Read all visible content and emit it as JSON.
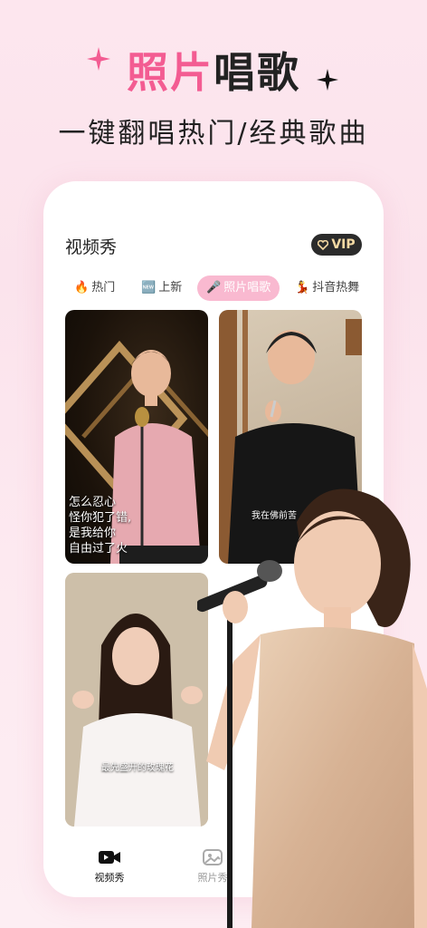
{
  "hero": {
    "title_pink": "照片",
    "title_dark": "唱歌",
    "subtitle": "一键翻唱热门/经典歌曲"
  },
  "app": {
    "title": "视频秀",
    "vip_label": "VIP",
    "tabs": [
      {
        "icon": "🔥",
        "label": "热门"
      },
      {
        "icon": "🆕",
        "label": "上新"
      },
      {
        "icon": "🎤",
        "label": "照片唱歌"
      },
      {
        "icon": "💃",
        "label": "抖音热舞"
      }
    ],
    "cards": [
      {
        "caption_lines": [
          "怎么忍心",
          "怪你犯了错,",
          "是我给你",
          "自由过了火"
        ]
      },
      {
        "caption": "我在佛前苦"
      },
      {
        "caption": "最先盛开的玫瑰花"
      }
    ],
    "nav": [
      {
        "label": "视频秀",
        "icon": "video-camera-icon"
      },
      {
        "label": "照片秀",
        "icon": "photo-icon"
      }
    ]
  },
  "colors": {
    "accent_pink": "#f35c92",
    "tab_active_bg": "#f9b9d0",
    "vip_bg": "#2b2b2b",
    "vip_text": "#f4d9a3"
  }
}
